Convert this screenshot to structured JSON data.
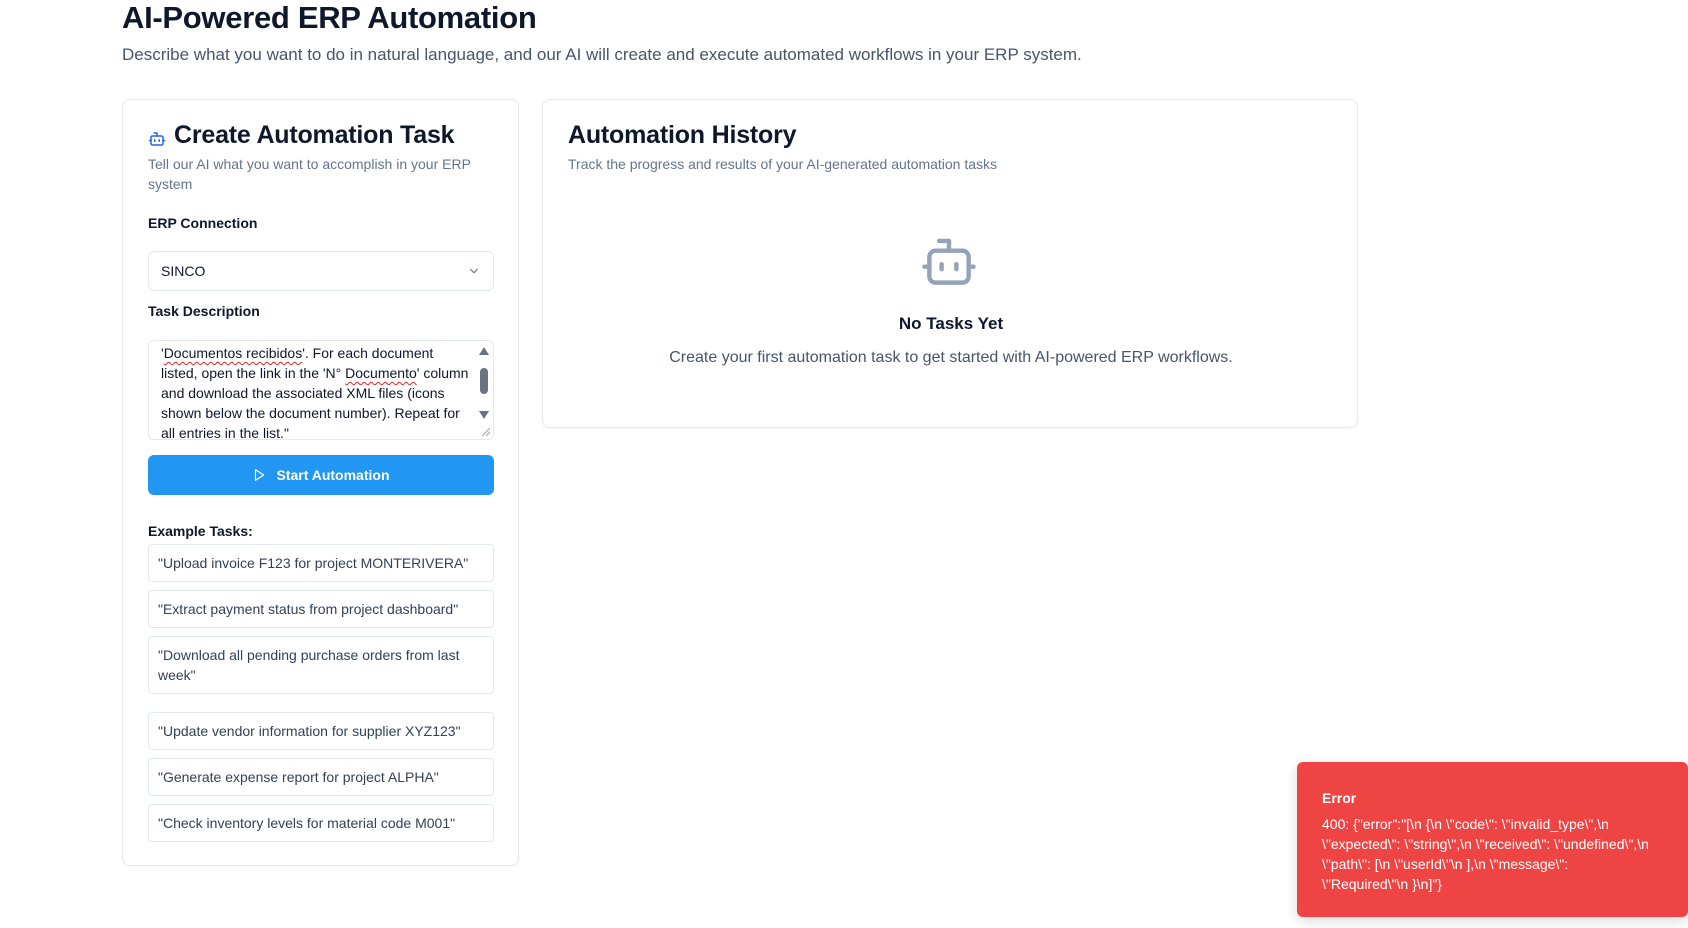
{
  "header": {
    "title": "AI-Powered ERP Automation",
    "subtitle": "Describe what you want to do in natural language, and our AI will create and execute automated workflows in your ERP system."
  },
  "create_card": {
    "icon": "robot-icon",
    "title": "Create Automation Task",
    "description": "Tell our AI what you want to accomplish in your ERP system",
    "erp_connection_label": "ERP Connection",
    "erp_connection_value": "SINCO",
    "task_description_label": "Task Description",
    "task_text_1": "'",
    "task_text_2": "Documentos recibidos",
    "task_text_3": "'. For each document listed, open the link in the 'N° ",
    "task_text_4": "Documento",
    "task_text_5": "' column and download the associated XML files (icons shown below the document number). Repeat for all entries in the list.\"",
    "start_button_label": "Start Automation",
    "examples_label": "Example Tasks:",
    "examples": [
      "\"Upload invoice F123 for project MONTERIVERA\"",
      "\"Extract payment status from project dashboard\"",
      "\"Download all pending purchase orders from last week\"",
      "\"Update vendor information for supplier XYZ123\"",
      "\"Generate expense report for project ALPHA\"",
      "\"Check inventory levels for material code M001\""
    ]
  },
  "history_card": {
    "title": "Automation History",
    "description": "Track the progress and results of your AI-generated automation tasks",
    "empty_icon": "robot-icon",
    "empty_title": "No Tasks Yet",
    "empty_description": "Create your first automation task to get started with AI-powered ERP workflows."
  },
  "toast": {
    "title": "Error",
    "message": "400: {\"error\":\"[\\n {\\n \\\"code\\\": \\\"invalid_type\\\",\\n \\\"expected\\\": \\\"string\\\",\\n \\\"received\\\": \\\"undefined\\\",\\n \\\"path\\\": [\\n \\\"userId\\\"\\n ],\\n \\\"message\\\": \\\"Required\\\"\\n }\\n]\"}",
    "color": "#ef4444"
  },
  "colors": {
    "primary_button": "#2196f3",
    "robot_icon_small": "#2563eb",
    "robot_icon_empty": "#94a3b8"
  }
}
